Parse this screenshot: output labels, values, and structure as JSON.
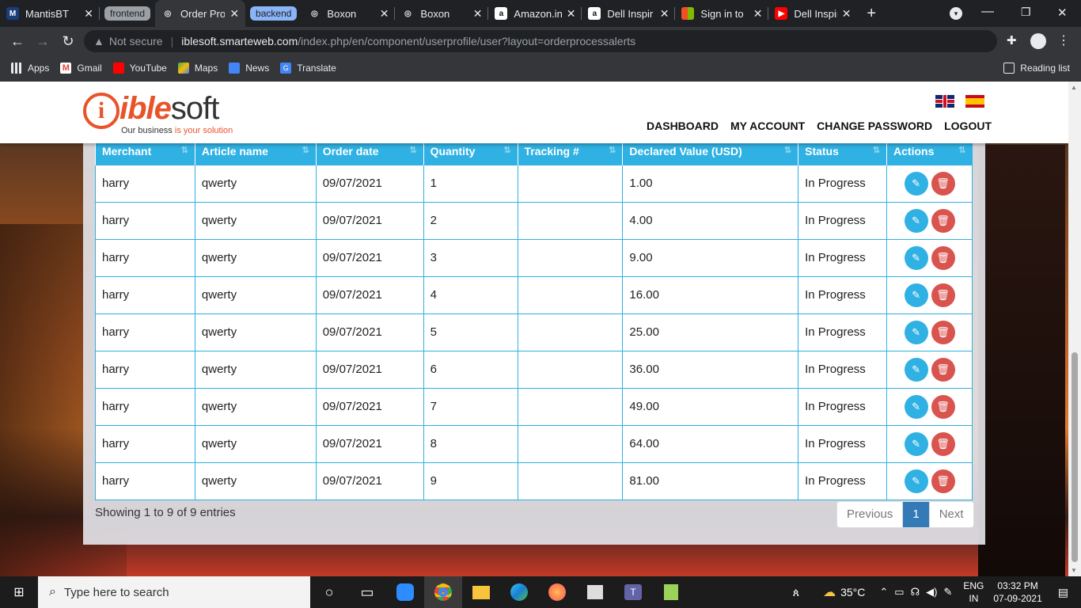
{
  "browser": {
    "tabs": [
      {
        "title": "MantisBT",
        "favicon": "mantis-icon",
        "color": "#1a3d7c"
      },
      {
        "group": "frontend",
        "group_color": "#9aa0a6"
      },
      {
        "title": "Order Proc",
        "favicon": "globe-icon",
        "active": true
      },
      {
        "group": "backend",
        "group_color": "#8ab4f8"
      },
      {
        "title": "Boxon",
        "favicon": "globe-icon"
      },
      {
        "title": "Boxon",
        "favicon": "globe-icon"
      },
      {
        "title": "Amazon.in",
        "favicon": "amazon-icon"
      },
      {
        "title": "Dell Inspir",
        "favicon": "amazon-icon"
      },
      {
        "title": "Sign in to",
        "favicon": "microsoft-icon"
      },
      {
        "title": "Dell Inspir",
        "favicon": "youtube-icon"
      }
    ],
    "url_prefix": "Not secure",
    "url_host": "iblesoft.smarteweb.com",
    "url_path": "/index.php/en/component/userprofile/user?layout=orderprocessalerts",
    "bookmarks": [
      "Apps",
      "Gmail",
      "YouTube",
      "Maps",
      "News",
      "Translate"
    ],
    "reading_list": "Reading list"
  },
  "site": {
    "logo_letter": "i",
    "logo_ible": "ible",
    "logo_soft": "soft",
    "tagline_a": "Our business ",
    "tagline_b": "is your solution",
    "menu": [
      "DASHBOARD",
      "MY ACCOUNT",
      "CHANGE PASSWORD",
      "LOGOUT"
    ],
    "accent": "#2fb1e3"
  },
  "table": {
    "columns": [
      "Merchant",
      "Article name",
      "Order date",
      "Quantity",
      "Tracking #",
      "Declared Value (USD)",
      "Status",
      "Actions"
    ],
    "rows": [
      [
        "harry",
        "qwerty",
        "09/07/2021",
        "1",
        "",
        "1.00",
        "In Progress"
      ],
      [
        "harry",
        "qwerty",
        "09/07/2021",
        "2",
        "",
        "4.00",
        "In Progress"
      ],
      [
        "harry",
        "qwerty",
        "09/07/2021",
        "3",
        "",
        "9.00",
        "In Progress"
      ],
      [
        "harry",
        "qwerty",
        "09/07/2021",
        "4",
        "",
        "16.00",
        "In Progress"
      ],
      [
        "harry",
        "qwerty",
        "09/07/2021",
        "5",
        "",
        "25.00",
        "In Progress"
      ],
      [
        "harry",
        "qwerty",
        "09/07/2021",
        "6",
        "",
        "36.00",
        "In Progress"
      ],
      [
        "harry",
        "qwerty",
        "09/07/2021",
        "7",
        "",
        "49.00",
        "In Progress"
      ],
      [
        "harry",
        "qwerty",
        "09/07/2021",
        "8",
        "",
        "64.00",
        "In Progress"
      ],
      [
        "harry",
        "qwerty",
        "09/07/2021",
        "9",
        "",
        "81.00",
        "In Progress"
      ]
    ],
    "info": "Showing 1 to 9 of 9 entries",
    "pager": {
      "prev": "Previous",
      "page": "1",
      "next": "Next"
    }
  },
  "taskbar": {
    "search_placeholder": "Type here to search",
    "weather": "35°C",
    "lang_a": "ENG",
    "lang_b": "IN",
    "time": "03:32 PM",
    "date": "07-09-2021"
  }
}
